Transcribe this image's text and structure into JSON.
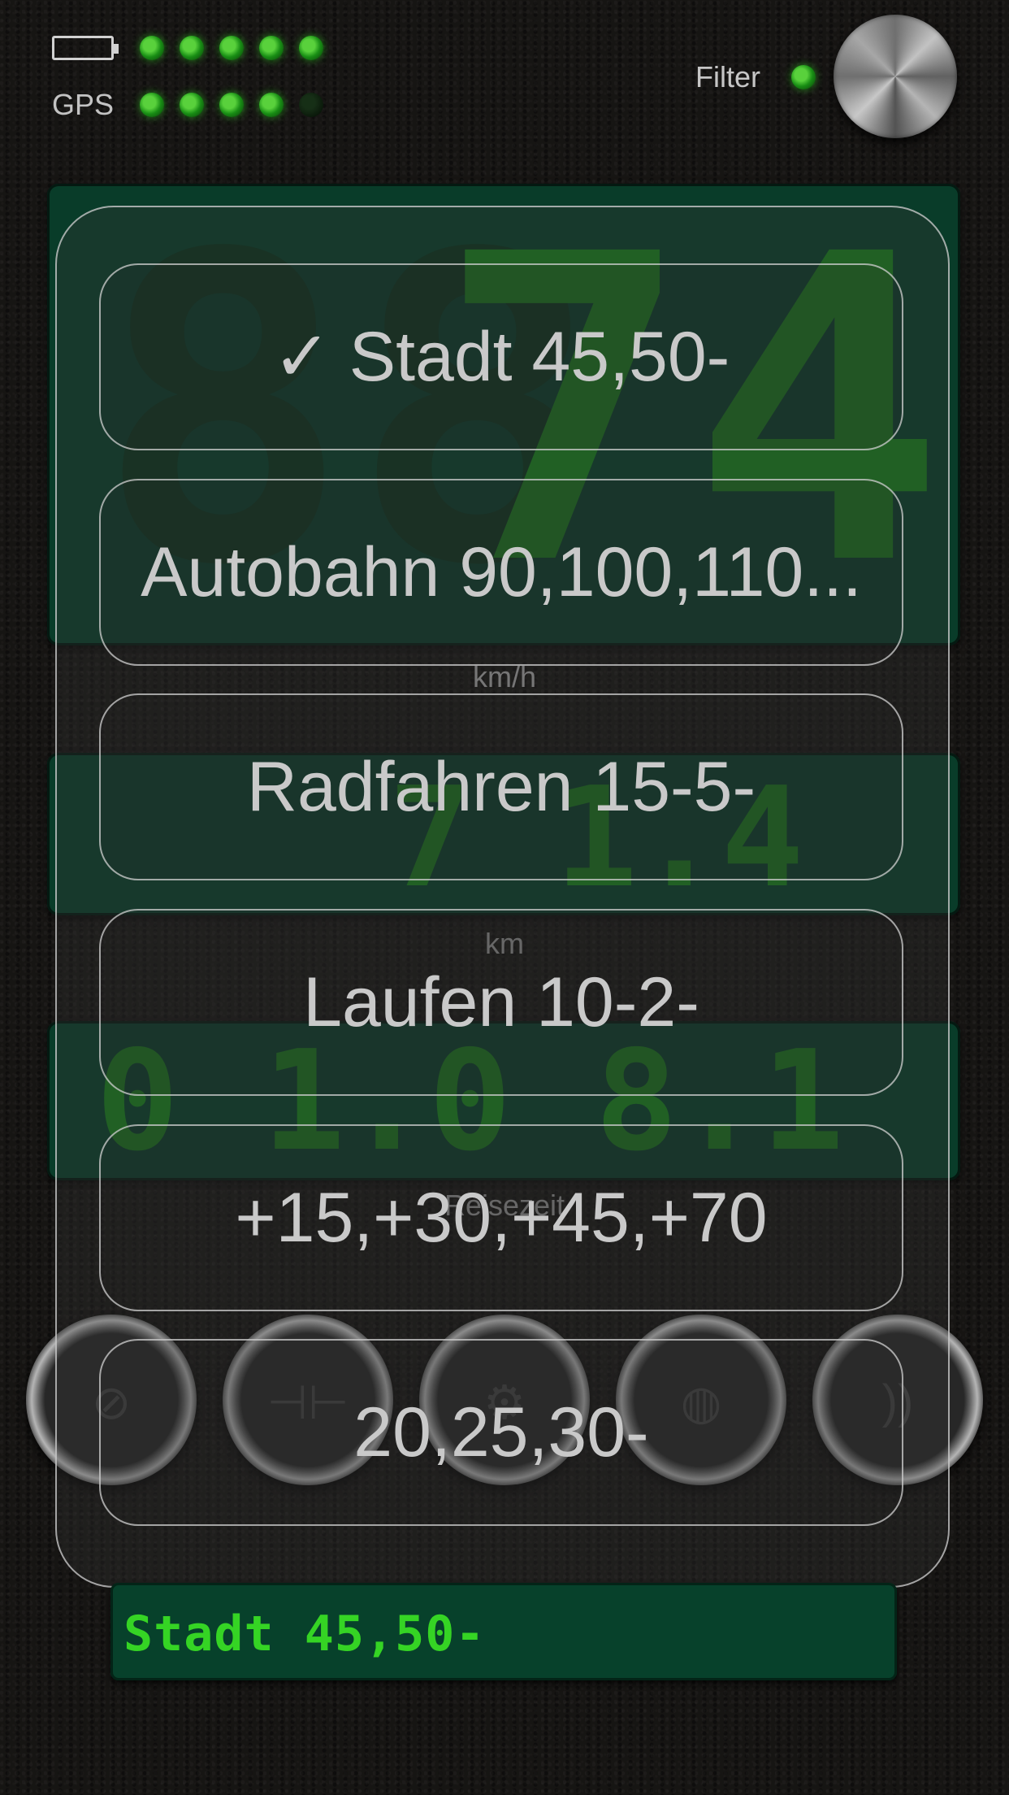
{
  "status": {
    "gps_label": "GPS",
    "filter_label": "Filter",
    "battery_leds_on": 5,
    "gps_leds_on": 4
  },
  "displays": {
    "speed_value": "74",
    "speed_unit": "km/h",
    "distance_value": "7 1.4 2",
    "distance_unit": "km",
    "time_value": "0 1.0 8.1 4",
    "time_unit": "Reisezeit"
  },
  "menu": {
    "check_mark": "✓",
    "options": [
      "Stadt 45,50-",
      "Autobahn 90,100,110...",
      "Radfahren 15-5-",
      "Laufen 10-2-",
      "+15,+30,+45,+70",
      "20,25,30-"
    ]
  },
  "bottom": {
    "selected_text": "Stadt 45,50-"
  },
  "icons": [
    "battery-icon",
    "led-indicator",
    "filter-knob-icon",
    "mute-icon",
    "counter-icon",
    "settings-gear-icon",
    "globe-icon",
    "voice-icon"
  ],
  "colors": {
    "led_green": "#4cff2e",
    "display_green": "#0c4a33",
    "segment_green": "#1f8f23",
    "text_green": "#35d424"
  }
}
